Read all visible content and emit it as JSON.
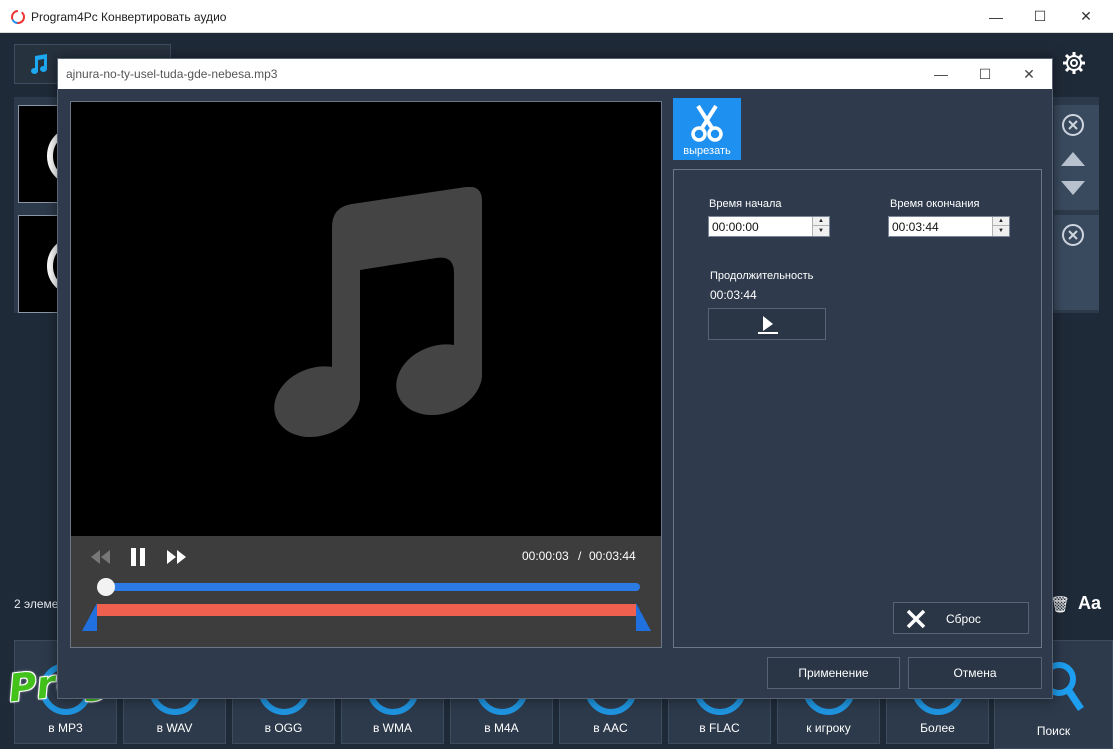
{
  "app": {
    "title": "Program4Pc Конвертировать аудио",
    "status_count": "2 элеме",
    "font_button": "Aa"
  },
  "formats": [
    {
      "label": "в MP3",
      "icon": "mp3-icon"
    },
    {
      "label": "в WAV",
      "icon": "wav-icon"
    },
    {
      "label": "в OGG",
      "icon": "ogg-icon"
    },
    {
      "label": "в WMA",
      "icon": "wma-icon"
    },
    {
      "label": "в M4A",
      "icon": "apple-icon"
    },
    {
      "label": "в AAC",
      "icon": "aac-icon"
    },
    {
      "label": "в FLAC",
      "icon": "flac-icon"
    },
    {
      "label": "к игроку",
      "icon": "player-icon"
    },
    {
      "label": "Более",
      "icon": "music-note-icon"
    }
  ],
  "search_label": "Поиск",
  "watermark": "Prog-Top.net",
  "dialog": {
    "title": "ajnura-no-ty-usel-tuda-gde-nebesa.mp3",
    "player": {
      "current_time": "00:00:03",
      "separator": "/",
      "total_time": "00:03:44",
      "progress": 0.013
    },
    "cut_tab_label": "вырезать",
    "start_label": "Время начала",
    "start_value": "00:00:00",
    "end_label": "Время окончания",
    "end_value": "00:03:44",
    "duration_label": "Продолжительность",
    "duration_value": "00:03:44",
    "reset_label": "Сброс",
    "apply_label": "Применение",
    "cancel_label": "Отмена"
  },
  "colors": {
    "accent": "#1e90f0",
    "range": "#f0604f",
    "seek": "#2c7be5",
    "watermark": "#43c21b"
  }
}
